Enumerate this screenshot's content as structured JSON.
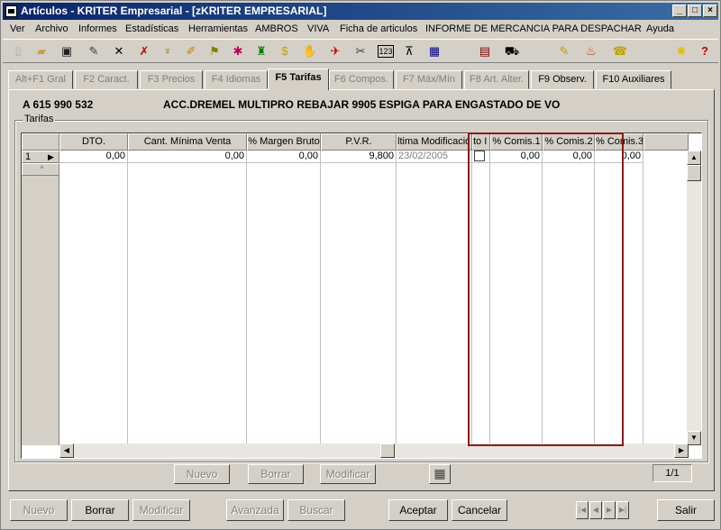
{
  "window": {
    "title": "Artículos - KRITER Empresarial - [zKRITER EMPRESARIAL]"
  },
  "menu": [
    "Ver",
    "Archivo",
    "Informes",
    "Estadísticas",
    "Herramientas",
    "AMBROS",
    "VIVA",
    "Ficha de articulos",
    "INFORME DE MERCANCIA PARA DESPACHAR",
    "Ayuda"
  ],
  "toolbar_icons": [
    "new-doc-icon",
    "open-folder-icon",
    "save-icon",
    "edit-icon",
    "delete-icon",
    "tool1-icon",
    "tool2-icon",
    "tool3-icon",
    "tool4-icon",
    "tool5-icon",
    "tool6-icon",
    "tool7-icon",
    "tool8-icon",
    "tool9-icon",
    "tool10-icon",
    "tool11-icon",
    "calc-123-icon",
    "tool12-icon",
    "tool13-icon",
    "calendar-icon",
    "cart-icon",
    "tool14-icon",
    "money-bag-icon",
    "phone-icon",
    "lightbulb-icon",
    "help-icon"
  ],
  "tabs": [
    {
      "label": "Alt+F1 Gral",
      "state": "disabled"
    },
    {
      "label": "F2 Caract.",
      "state": "disabled"
    },
    {
      "label": "F3 Precios",
      "state": "disabled"
    },
    {
      "label": "F4 Idiomas",
      "state": "disabled"
    },
    {
      "label": "F5 Tarifas",
      "state": "active"
    },
    {
      "label": "F6 Compos.",
      "state": "disabled"
    },
    {
      "label": "F7 Máx/Mín",
      "state": "disabled"
    },
    {
      "label": "F8 Art. Alter.",
      "state": "disabled"
    },
    {
      "label": "F9 Observ.",
      "state": "enabled"
    },
    {
      "label": "F10 Auxiliares",
      "state": "enabled"
    }
  ],
  "article": {
    "code": "A 615 990 532",
    "description": "ACC.DREMEL MULTIPRO REBAJAR 9905 ESPIGA PARA ENGASTADO DE VO"
  },
  "group_label": "Tarifas",
  "grid": {
    "columns": [
      "DTO.",
      "Cant. Mínima Venta",
      "% Margen Bruto",
      "P.V.R.",
      "ltima Modificació",
      "",
      "to I",
      "% Comis.1",
      "% Comis.2",
      "% Comis.3"
    ],
    "rows": [
      {
        "index": "1",
        "dto": "0,00",
        "cant": "0,00",
        "margen": "0,00",
        "pvr": "9,800",
        "fecha": "23/02/2005",
        "comis1": "0,00",
        "comis2": "0,00",
        "comis3": "0,00"
      }
    ],
    "new_row_marker": "*"
  },
  "grid_buttons": {
    "nuevo": "Nuevo",
    "borrar": "Borrar",
    "modificar": "Modificar"
  },
  "pager": "1/1",
  "footer_buttons": {
    "nuevo": "Nuevo",
    "borrar": "Borrar",
    "modificar": "Modificar",
    "avanzada": "Avanzada",
    "buscar": "Buscar",
    "aceptar": "Aceptar",
    "cancelar": "Cancelar",
    "salir": "Salir"
  },
  "colors": {
    "title_bar": "#0a246a",
    "highlight_box": "#8b1a1a"
  }
}
